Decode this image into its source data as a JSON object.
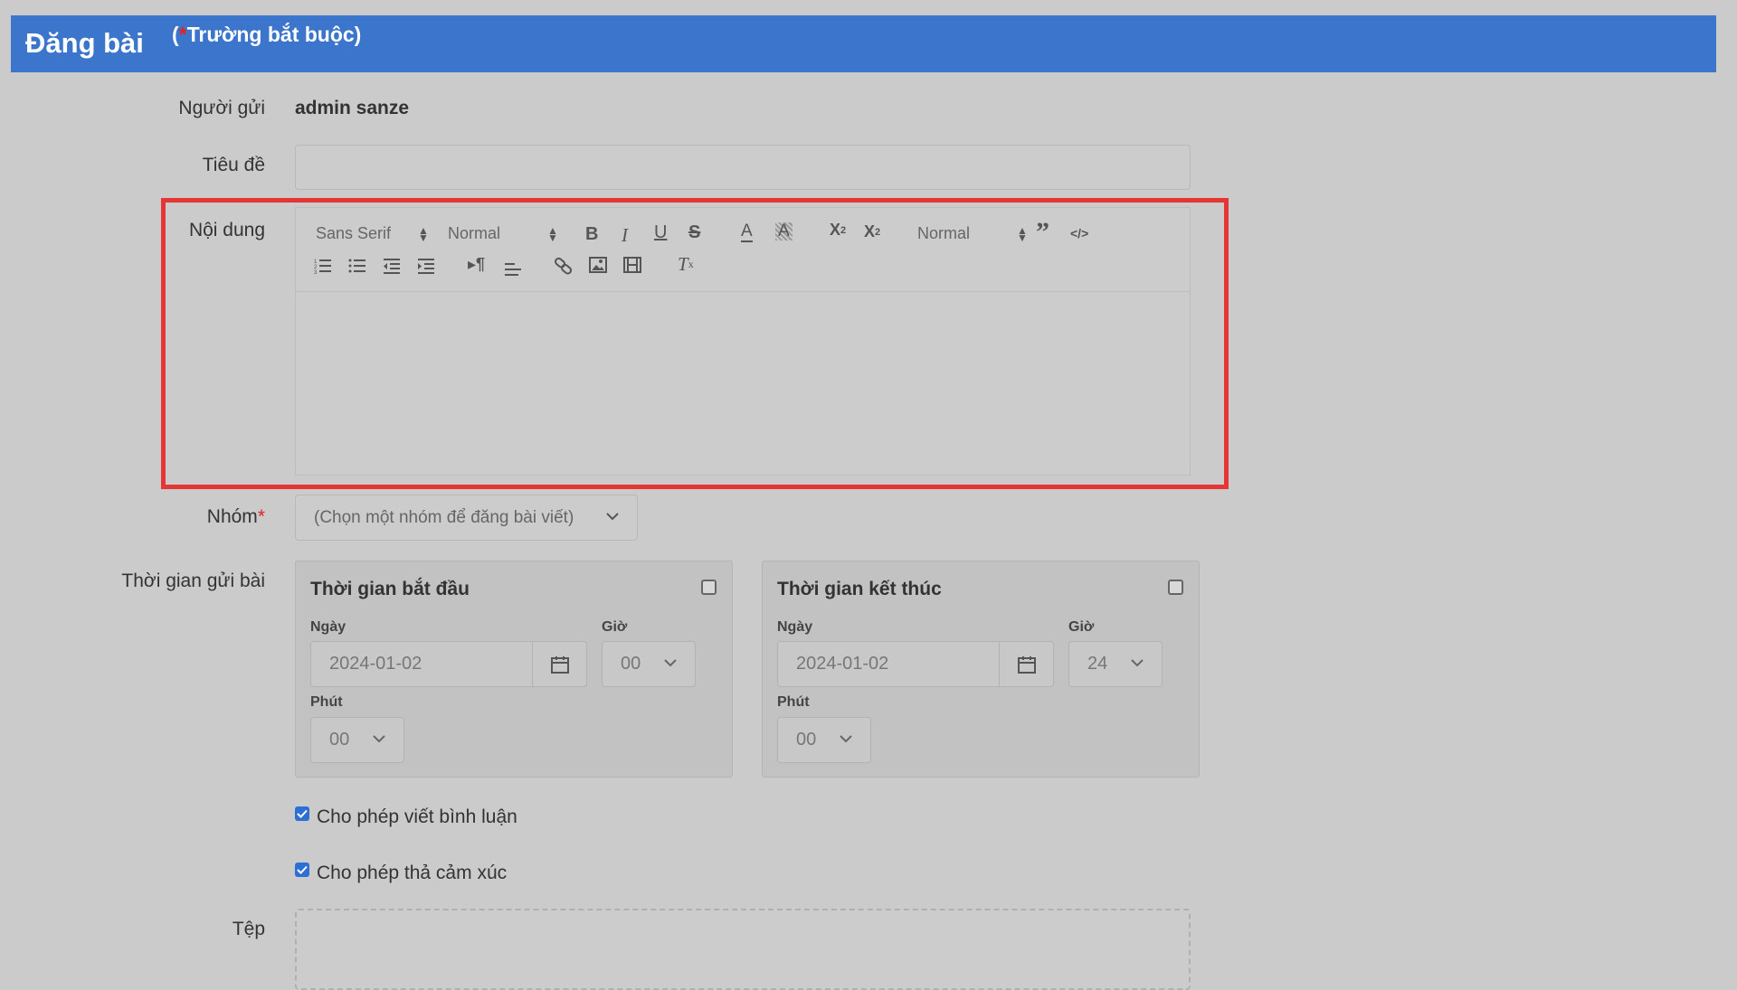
{
  "header": {
    "title": "Đăng bài",
    "required_prefix": "(",
    "required_star": "*",
    "required_text": "Trường bắt buộc)"
  },
  "form": {
    "sender_label": "Người gửi",
    "sender_value": "admin sanze",
    "title_label": "Tiêu đề",
    "title_value": "",
    "content_label": "Nội dung",
    "group_label": "Nhóm",
    "group_required": "*",
    "group_placeholder": "(Chọn một nhóm để đăng bài viết)",
    "schedule_label": "Thời gian gửi bài",
    "file_label": "Tệp"
  },
  "editor": {
    "font_select": "Sans Serif",
    "size_select": "Normal",
    "header_select": "Normal",
    "icons": [
      "bold-icon",
      "italic-icon",
      "underline-icon",
      "strikethrough-icon",
      "text-color-icon",
      "background-color-icon",
      "superscript-icon",
      "subscript-icon",
      "blockquote-icon",
      "code-block-icon",
      "ordered-list-icon",
      "bullet-list-icon",
      "outdent-icon",
      "indent-icon",
      "rtl-direction-icon",
      "align-icon",
      "link-icon",
      "image-icon",
      "video-icon",
      "clean-format-icon"
    ]
  },
  "schedule": {
    "start": {
      "title": "Thời gian bắt đầu",
      "date_label": "Ngày",
      "date_value": "2024-01-02",
      "hour_label": "Giờ",
      "hour_value": "00",
      "minute_label": "Phút",
      "minute_value": "00"
    },
    "end": {
      "title": "Thời gian kết thúc",
      "date_label": "Ngày",
      "date_value": "2024-01-02",
      "hour_label": "Giờ",
      "hour_value": "24",
      "minute_label": "Phút",
      "minute_value": "00"
    }
  },
  "options": {
    "allow_comments": "Cho phép viết bình luận",
    "allow_reactions": "Cho phép thả cảm xúc"
  },
  "colors": {
    "header_bg": "#3b76cc",
    "highlight": "#e53535",
    "checkbox": "#2e6fd6"
  }
}
